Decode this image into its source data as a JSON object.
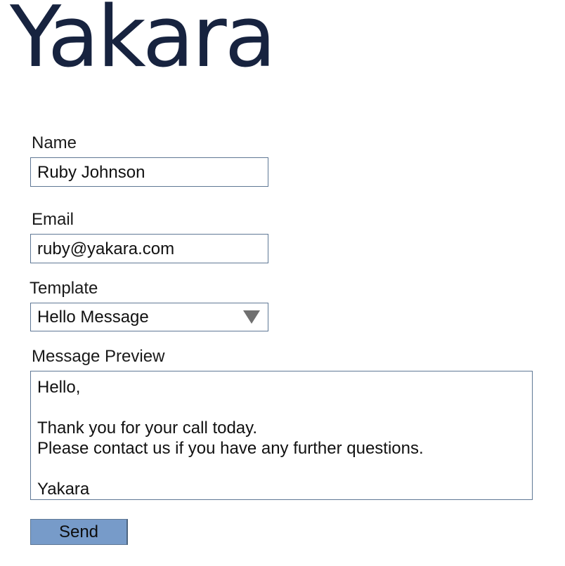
{
  "brand": {
    "logo_text": "Yakara",
    "color": "#17233f"
  },
  "form": {
    "name": {
      "label": "Name",
      "value": "Ruby Johnson"
    },
    "email": {
      "label": "Email",
      "value": "ruby@yakara.com"
    },
    "template": {
      "label": "Template",
      "selected": "Hello Message",
      "icon": "triangle-down-icon"
    },
    "preview": {
      "label": "Message Preview",
      "text": "Hello,\n\nThank you for your call today.\nPlease contact us if you have any further questions.\n\nYakara"
    },
    "send_label": "Send"
  },
  "colors": {
    "field_border": "#5f7895",
    "button_bg": "#779bc9"
  }
}
